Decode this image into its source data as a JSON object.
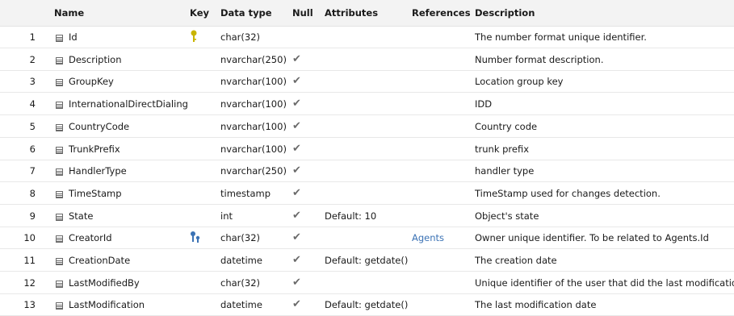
{
  "header": {
    "name": "Name",
    "key": "Key",
    "data_type": "Data type",
    "null": "Null",
    "attributes": "Attributes",
    "references": "References",
    "description": "Description"
  },
  "colors": {
    "header_bg": "#f3f3f3",
    "primary_key": "#c9b400",
    "foreign_key": "#3c73b5",
    "link": "#3c73b5",
    "check": "#6a6a6a"
  },
  "rows": [
    {
      "num": "1",
      "name": "Id",
      "key": "primary-key-icon",
      "type": "char(32)",
      "null": false,
      "attributes": "",
      "references": "",
      "description": "The number format unique identifier."
    },
    {
      "num": "2",
      "name": "Description",
      "key": "",
      "type": "nvarchar(250)",
      "null": true,
      "attributes": "",
      "references": "",
      "description": "Number format description."
    },
    {
      "num": "3",
      "name": "GroupKey",
      "key": "",
      "type": "nvarchar(100)",
      "null": true,
      "attributes": "",
      "references": "",
      "description": "Location group key"
    },
    {
      "num": "4",
      "name": "InternationalDirectDialing",
      "key": "",
      "type": "nvarchar(100)",
      "null": true,
      "attributes": "",
      "references": "",
      "description": "IDD"
    },
    {
      "num": "5",
      "name": "CountryCode",
      "key": "",
      "type": "nvarchar(100)",
      "null": true,
      "attributes": "",
      "references": "",
      "description": "Country code"
    },
    {
      "num": "6",
      "name": "TrunkPrefix",
      "key": "",
      "type": "nvarchar(100)",
      "null": true,
      "attributes": "",
      "references": "",
      "description": "trunk prefix"
    },
    {
      "num": "7",
      "name": "HandlerType",
      "key": "",
      "type": "nvarchar(250)",
      "null": true,
      "attributes": "",
      "references": "",
      "description": "handler type"
    },
    {
      "num": "8",
      "name": "TimeStamp",
      "key": "",
      "type": "timestamp",
      "null": true,
      "attributes": "",
      "references": "",
      "description": "TimeStamp used for changes detection."
    },
    {
      "num": "9",
      "name": "State",
      "key": "",
      "type": "int",
      "null": true,
      "attributes": "Default: 10",
      "references": "",
      "description": "Object's state"
    },
    {
      "num": "10",
      "name": "CreatorId",
      "key": "foreign-key-icon",
      "type": "char(32)",
      "null": true,
      "attributes": "",
      "references": "Agents",
      "description": "Owner unique identifier. To be related to Agents.Id"
    },
    {
      "num": "11",
      "name": "CreationDate",
      "key": "",
      "type": "datetime",
      "null": true,
      "attributes": "Default: getdate()",
      "references": "",
      "description": "The creation date"
    },
    {
      "num": "12",
      "name": "LastModifiedBy",
      "key": "",
      "type": "char(32)",
      "null": true,
      "attributes": "",
      "references": "",
      "description": "Unique identifier of the user that did the last modifications"
    },
    {
      "num": "13",
      "name": "LastModification",
      "key": "",
      "type": "datetime",
      "null": true,
      "attributes": "Default: getdate()",
      "references": "",
      "description": "The last modification date"
    }
  ]
}
